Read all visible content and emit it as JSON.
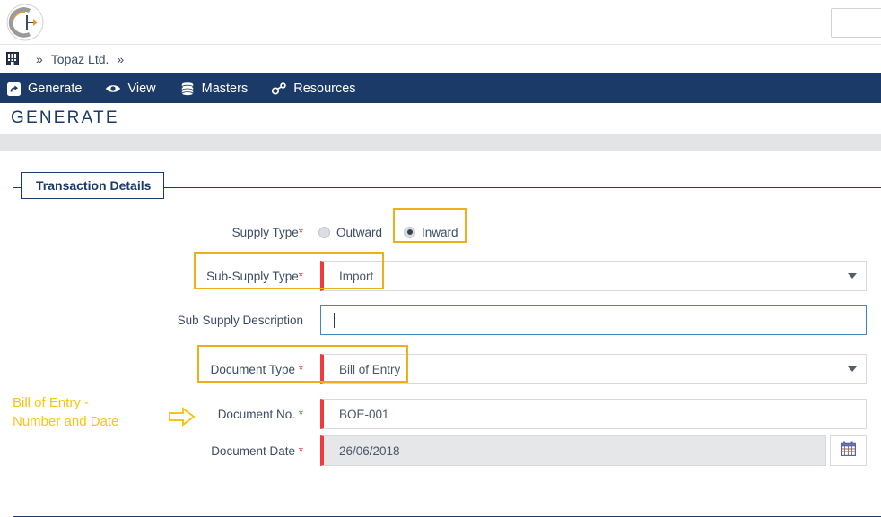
{
  "app": {
    "logo_alt": "company-logo"
  },
  "breadcrumb": {
    "home_icon": "building-icon",
    "separator": "»",
    "company": "Topaz Ltd."
  },
  "nav": {
    "items": [
      {
        "label": "Generate",
        "icon": "generate-icon"
      },
      {
        "label": "View",
        "icon": "eye-icon"
      },
      {
        "label": "Masters",
        "icon": "database-icon"
      },
      {
        "label": "Resources",
        "icon": "link-icon"
      }
    ]
  },
  "page": {
    "title": "GENERATE"
  },
  "form": {
    "legend": "Transaction Details",
    "supply_type": {
      "label": "Supply Type",
      "required_mark": "*",
      "options": [
        {
          "label": "Outward",
          "selected": false
        },
        {
          "label": "Inward",
          "selected": true
        }
      ]
    },
    "sub_supply_type": {
      "label": "Sub-Supply Type",
      "required_mark": "*",
      "value": "Import",
      "caret_icon": "chevron-down-icon"
    },
    "sub_supply_description": {
      "label": "Sub Supply Description",
      "value": "",
      "placeholder": ""
    },
    "document_type": {
      "label": "Document Type ",
      "required_mark": "*",
      "value": "Bill of Entry",
      "caret_icon": "chevron-down-icon"
    },
    "document_no": {
      "label": "Document No. ",
      "required_mark": "*",
      "value": "BOE-001"
    },
    "document_date": {
      "label": "Document Date ",
      "required_mark": "*",
      "value": "26/06/2018",
      "calendar_icon": "calendar-icon"
    }
  },
  "annotations": {
    "bill_of_entry_note": "Bill of Entry -\nNumber and Date",
    "arrow_icon": "arrow-right-icon"
  },
  "colors": {
    "navy": "#1b3a68",
    "amber": "#edaf1b",
    "annotation_text": "#f5c518",
    "required_red": "#e34b4b",
    "input_accent_red": "#ef3b3b",
    "focus_blue": "#3e89b5"
  }
}
